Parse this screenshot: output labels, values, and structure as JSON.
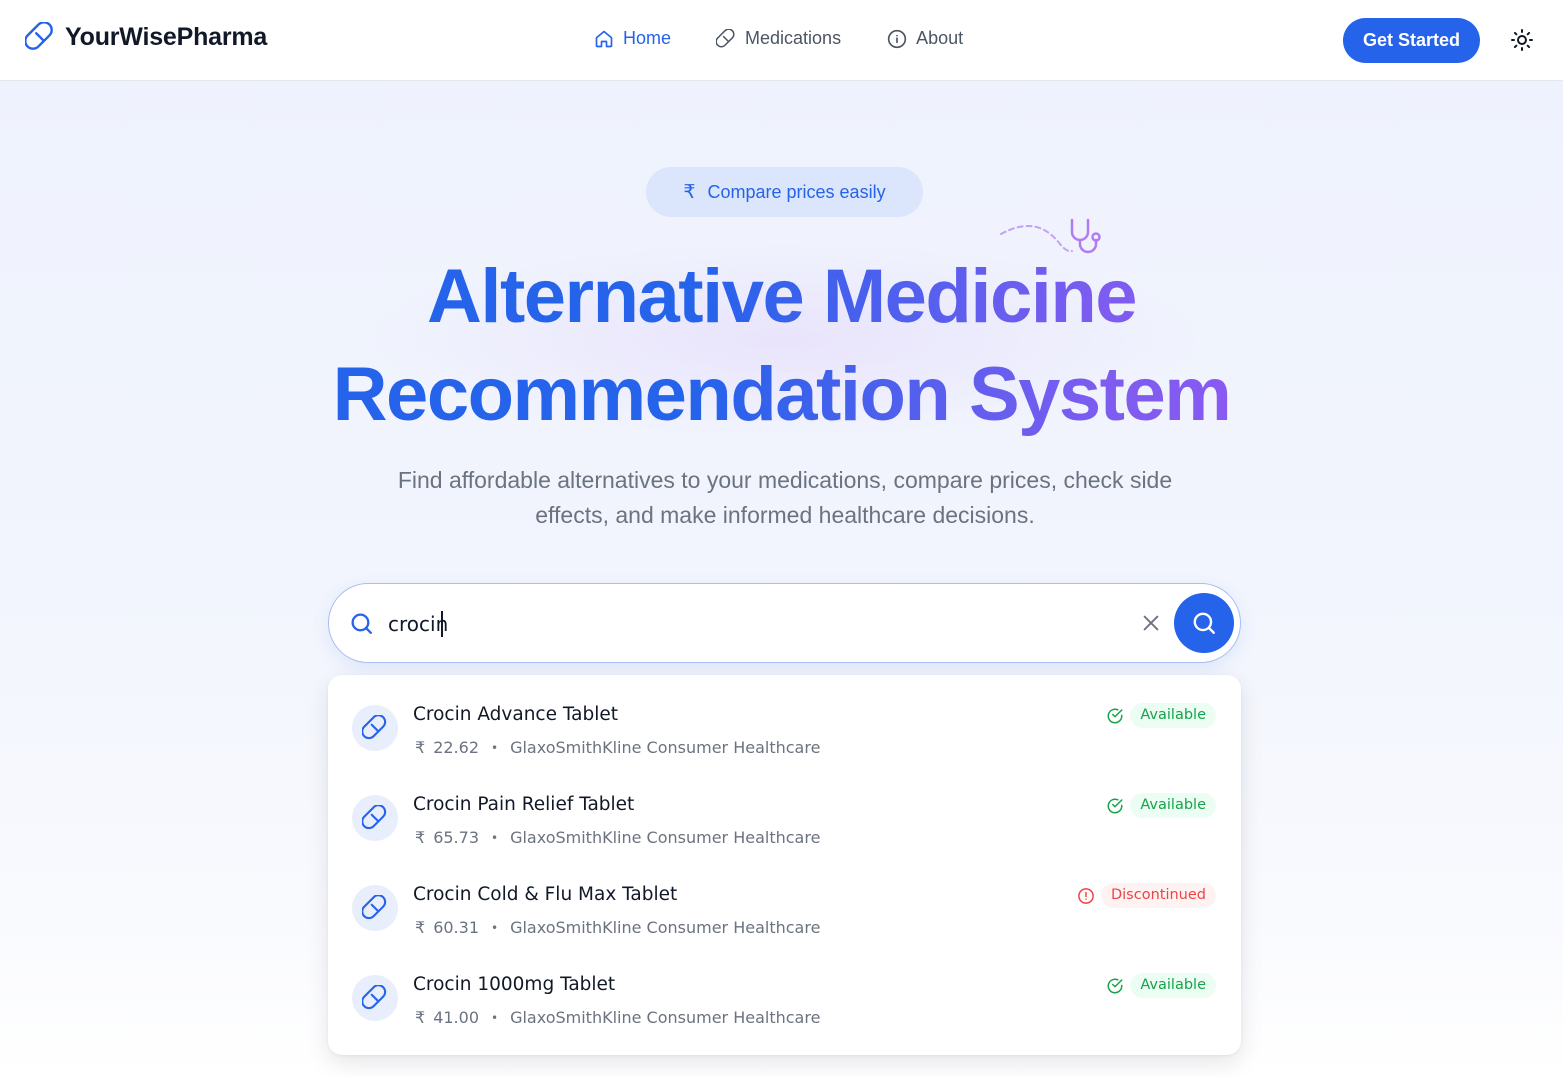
{
  "header": {
    "brand": "YourWisePharma",
    "nav": [
      {
        "label": "Home",
        "icon": "home-icon",
        "active": true
      },
      {
        "label": "Medications",
        "icon": "pill-icon",
        "active": false
      },
      {
        "label": "About",
        "icon": "info-icon",
        "active": false
      }
    ],
    "cta_label": "Get Started",
    "theme_icon": "sun-icon"
  },
  "hero": {
    "pill_icon": "₹",
    "pill_text": "Compare prices easily",
    "title_line1_a": "Alternative ",
    "title_line1_b": "Medicine",
    "title_line2_a": "Recommendation ",
    "title_line2_b": "System",
    "subtitle": "Find affordable alternatives to your medications, compare prices, check side effects, and make informed healthcare decisions."
  },
  "search": {
    "value": "crocin",
    "placeholder": ""
  },
  "results": [
    {
      "name": "Crocin Advance Tablet",
      "currency": "₹",
      "price": "22.62",
      "manufacturer": "GlaxoSmithKline Consumer Healthcare",
      "status": "Available"
    },
    {
      "name": "Crocin Pain Relief Tablet",
      "currency": "₹",
      "price": "65.73",
      "manufacturer": "GlaxoSmithKline Consumer Healthcare",
      "status": "Available"
    },
    {
      "name": "Crocin Cold & Flu Max Tablet",
      "currency": "₹",
      "price": "60.31",
      "manufacturer": "GlaxoSmithKline Consumer Healthcare",
      "status": "Discontinued"
    },
    {
      "name": "Crocin 1000mg Tablet",
      "currency": "₹",
      "price": "41.00",
      "manufacturer": "GlaxoSmithKline Consumer Healthcare",
      "status": "Available"
    }
  ],
  "colors": {
    "primary": "#2563eb",
    "accent": "#a855f7",
    "available": "#16a34a",
    "discontinued": "#ef4444"
  }
}
